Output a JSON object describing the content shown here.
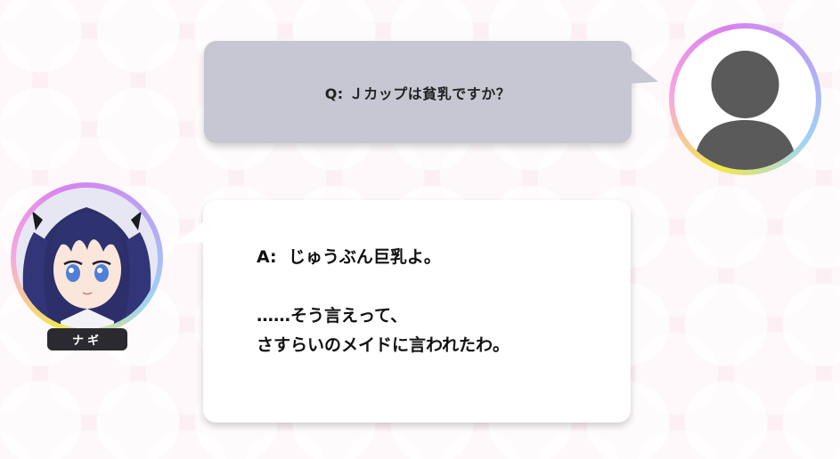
{
  "question": {
    "text": "Q:  Ｊカップは貧乳ですか？"
  },
  "answer": {
    "text": "A:  じゅうぶん巨乳よ。\n\n……そう言えって、\nさすらいのメイドに言われたわ。"
  },
  "character": {
    "name": "ナギ"
  },
  "icons": {
    "user_avatar": "user-silhouette-icon",
    "character_avatar": "character-portrait"
  },
  "colors": {
    "question_bubble": "#c7c7d3",
    "answer_bubble": "#ffffff",
    "name_tag": "#2a2a30"
  }
}
